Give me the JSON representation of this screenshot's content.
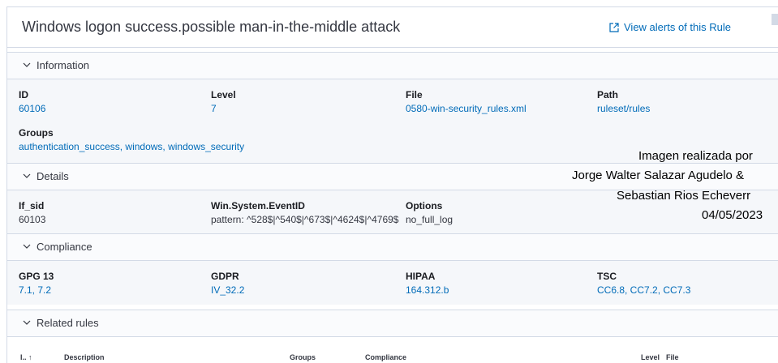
{
  "header": {
    "title": "Windows logon success.possible man-in-the-middle attack",
    "view_alerts_label": "View alerts of this Rule"
  },
  "information": {
    "label": "Information",
    "id": {
      "key": "ID",
      "value": "60106"
    },
    "level": {
      "key": "Level",
      "value": "7"
    },
    "file": {
      "key": "File",
      "value": "0580-win-security_rules.xml"
    },
    "path": {
      "key": "Path",
      "value": "ruleset/rules"
    },
    "groups": {
      "key": "Groups",
      "value": "authentication_success, windows, windows_security"
    }
  },
  "details": {
    "label": "Details",
    "if_sid": {
      "key": "If_sid",
      "value": "60103"
    },
    "event_id": {
      "key": "Win.System.EventID",
      "value": "pattern: ^528$|^540$|^673$|^4624$|^4769$"
    },
    "options": {
      "key": "Options",
      "value": "no_full_log"
    }
  },
  "compliance": {
    "label": "Compliance",
    "gpg13": {
      "key": "GPG 13",
      "value": "7.1, 7.2"
    },
    "gdpr": {
      "key": "GDPR",
      "value": "IV_32.2"
    },
    "hipaa": {
      "key": "HIPAA",
      "value": "164.312.b"
    },
    "tsc": {
      "key": "TSC",
      "value": "CC6.8, CC7.2, CC7.3"
    }
  },
  "related": {
    "label": "Related rules",
    "columns": [
      "I.. ↑",
      "Description",
      "Groups",
      "Compliance",
      "Level",
      "File"
    ]
  },
  "watermark": {
    "line1": "Imagen realizada por",
    "line2": "Jorge Walter Salazar Agudelo &",
    "line3": "Sebastian Rios Echeverr",
    "line4": "04/05/2023"
  }
}
